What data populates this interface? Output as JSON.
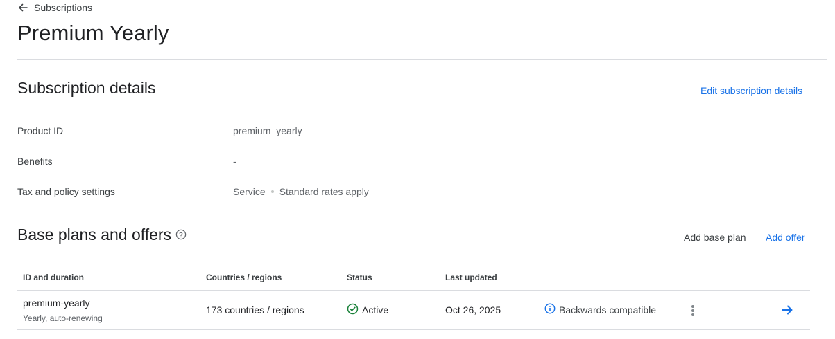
{
  "header": {
    "back_label": "Subscriptions",
    "title": "Premium Yearly"
  },
  "details": {
    "title": "Subscription details",
    "edit_label": "Edit subscription details",
    "rows": [
      {
        "label": "Product ID",
        "value": "premium_yearly"
      },
      {
        "label": "Benefits",
        "value": "-"
      },
      {
        "label": "Tax and policy settings",
        "value_primary": "Service",
        "value_secondary": "Standard rates apply"
      }
    ]
  },
  "plans": {
    "title": "Base plans and offers",
    "add_base_plan_label": "Add base plan",
    "add_offer_label": "Add offer",
    "columns": [
      "ID and duration",
      "Countries / regions",
      "Status",
      "Last updated"
    ],
    "rows": [
      {
        "id": "premium-yearly",
        "duration": "Yearly, auto-renewing",
        "countries": "173 countries / regions",
        "status": "Active",
        "last_updated": "Oct 26, 2025",
        "compatibility": "Backwards compatible"
      }
    ]
  },
  "colors": {
    "accent": "#1a73e8",
    "active_green": "#188038",
    "divider": "#dadce0"
  },
  "icons": {
    "back": "arrow-left-icon",
    "help": "help-circle-icon",
    "status": "check-circle-icon",
    "info": "info-icon",
    "more": "more-vert-icon",
    "open": "arrow-right-icon"
  }
}
